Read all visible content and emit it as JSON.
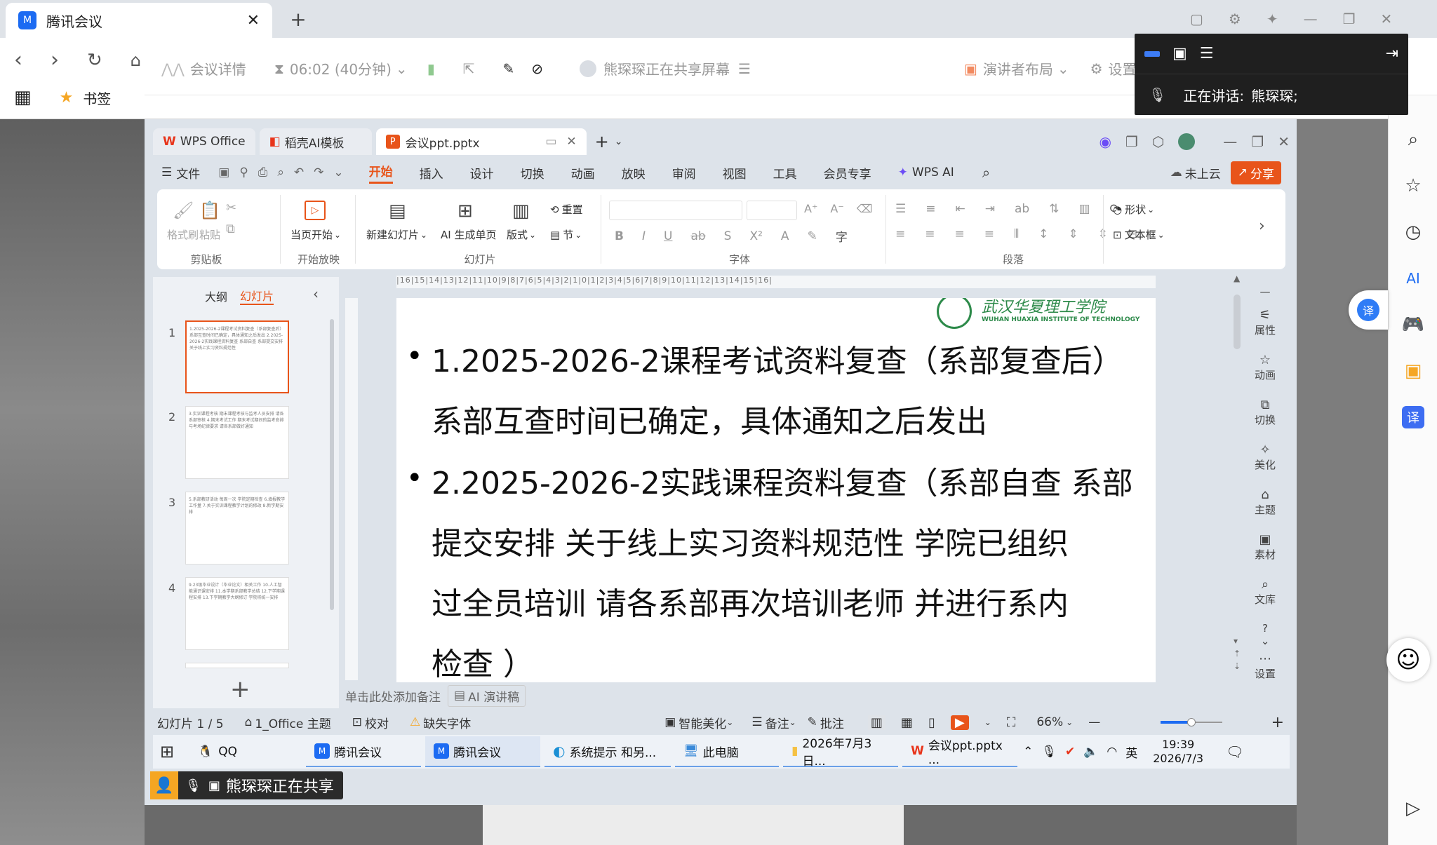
{
  "browser": {
    "tab_title": "腾讯会议",
    "bookmark_label": "书签",
    "partial_label": "签"
  },
  "meeting": {
    "details": "会议详情",
    "timer": "06:02 (40分钟)",
    "presenter_status": "熊琛琛正在共享屏幕",
    "layout_label": "演讲者布局",
    "settings_label": "设置",
    "speaking_label": "正在讲话:",
    "speaker_name": "熊琛琛;"
  },
  "wps": {
    "tabs": [
      "WPS Office",
      "稻壳AI模板",
      "会议ppt.pptx"
    ],
    "menu": [
      "文件",
      "开始",
      "插入",
      "设计",
      "切换",
      "动画",
      "放映",
      "审阅",
      "视图",
      "工具",
      "会员专享",
      "WPS AI"
    ],
    "cloud_label": "未上云",
    "share_label": "分享",
    "ribbon": {
      "format_painter": "格式刷",
      "paste": "粘贴",
      "play_from_current": "当页开始",
      "new_slide": "新建幻灯片",
      "ai_single_page": "AI 生成单页",
      "layout": "版式",
      "reset": "重置",
      "section": "节",
      "shape": "形状",
      "textbox": "文本框",
      "groups": [
        "剪贴板",
        "开始放映",
        "幻灯片",
        "字体",
        "段落"
      ]
    },
    "outline_tab": "大纲",
    "slides_tab": "幻灯片",
    "thumb_texts": [
      "1.2025-2026-2课程考试资料复查（系部复查后）系部互查时间已确定，具体通知之后发出 2.2025-2026-2实践课程资料复查 系部自查 系部提交安排 关于线上实习资料规范性",
      "3.实训课程考核 期末课程考核与监考人员安排 请各系部审核 4.期末考试工作 期末考试期间的监考安排与考场纪律要求 请各系部做好通知",
      "5.系部教研活动 每周一次 学院定期检查 6.填报教学工作量 7.关于实训课程教学计划的修改 8.新学期安排",
      "9.23级毕业设计（毕业论文）相关工作 10.人工智能通识课安排 11.本学期系部教学总结 12.下学期课程安排 13.下学期教学大纲修订 学院将统一安排"
    ],
    "slide_lines": [
      "1.2025-2026-2课程考试资料复查（系部复查后）",
      "系部互查时间已确定，具体通知之后发出",
      "2.2025-2026-2实践课程资料复查（系部自查 系部",
      "提交安排 关于线上实习资料规范性 学院已组织",
      "过全员培训 请各系部再次培训老师 并进行系内",
      "检查 ）"
    ],
    "logo_cn": "武汉华夏理工学院",
    "logo_en": "WUHAN HUAXIA INSTITUTE OF TECHNOLOGY",
    "ruler_text": "|16|15|14|13|12|11|10|9|8|7|6|5|4|3|2|1|0|1|2|3|4|5|6|7|8|9|10|11|12|13|14|15|16|",
    "note_placeholder": "单击此处添加备注",
    "ai_script": "AI 演讲稿",
    "right_tools": [
      "属性",
      "动画",
      "切换",
      "美化",
      "主题",
      "素材",
      "文库",
      "设置"
    ],
    "status": {
      "slide_count": "幻灯片 1 / 5",
      "theme": "1_Office 主题",
      "proofread": "校对",
      "missing_font": "缺失字体",
      "smart_beautify": "智能美化",
      "notes": "备注",
      "comments": "批注",
      "zoom": "66%"
    }
  },
  "taskbar": {
    "items": [
      "QQ",
      "腾讯会议",
      "腾讯会议",
      "系统提示 和另...",
      "此电脑",
      "2026年7月3日...",
      "会议ppt.pptx ..."
    ],
    "ime": "英",
    "time": "19:39",
    "date": "2026/7/3"
  },
  "share_notice": "熊琛琛正在共享",
  "colors": {
    "accent": "#e8541a",
    "tencent_blue": "#1c6bf2",
    "dark": "#1f1f1f"
  }
}
